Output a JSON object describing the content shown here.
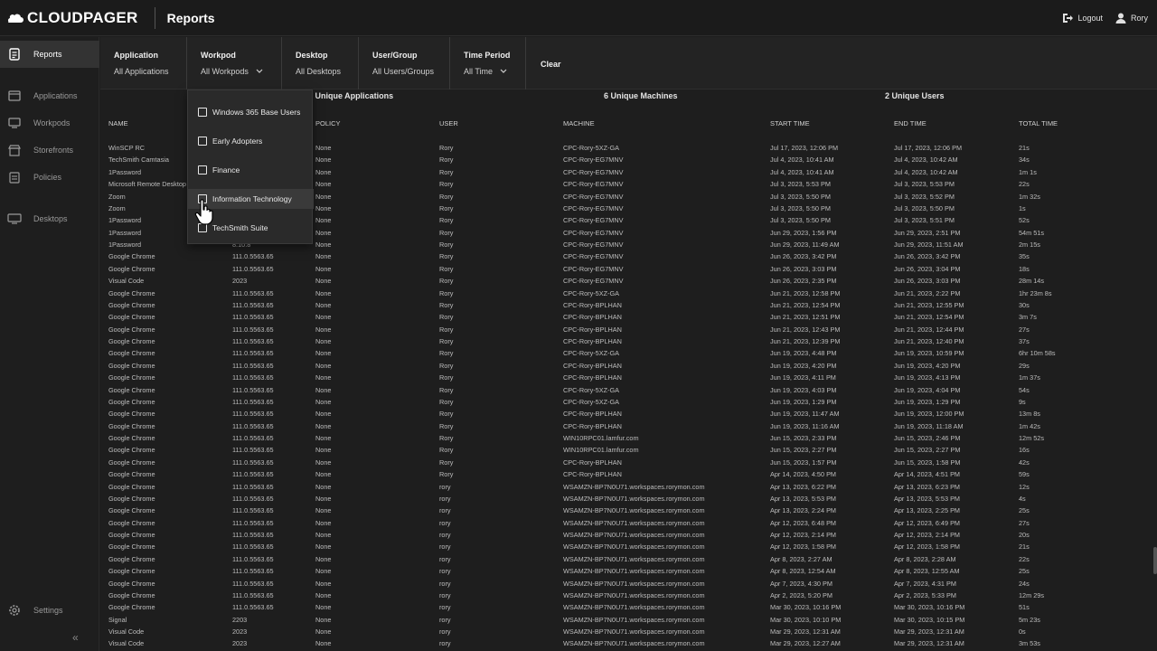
{
  "app": {
    "brand": "CLOUDPAGER",
    "page_title": "Reports",
    "logout_label": "Logout",
    "user_label": "Rory"
  },
  "sidebar": {
    "items": [
      {
        "label": "Reports",
        "icon": "report-icon"
      },
      {
        "label": "Applications",
        "icon": "applications-icon"
      },
      {
        "label": "Workpods",
        "icon": "workpods-icon"
      },
      {
        "label": "Storefronts",
        "icon": "storefront-icon"
      },
      {
        "label": "Policies",
        "icon": "policies-icon"
      },
      {
        "label": "Desktops",
        "icon": "desktops-icon"
      },
      {
        "label": "Settings",
        "icon": "gear-icon"
      }
    ],
    "collapse_glyph": "«"
  },
  "filters": {
    "application": {
      "label": "Application",
      "value": "All Applications"
    },
    "workpod": {
      "label": "Workpod",
      "value": "All Workpods"
    },
    "desktop": {
      "label": "Desktop",
      "value": "All Desktops"
    },
    "usergroup": {
      "label": "User/Group",
      "value": "All Users/Groups"
    },
    "time_period": {
      "label": "Time Period",
      "value": "All Time"
    },
    "clear_label": "Clear"
  },
  "summary": {
    "apps": "8 Unique Applications",
    "machines": "6 Unique Machines",
    "users": "2 Unique Users"
  },
  "dropdown": {
    "options": [
      "Windows 365 Base Users",
      "Early Adopters",
      "Finance",
      "Information Technology",
      "TechSmith Suite"
    ]
  },
  "table": {
    "headers": {
      "name": "NAME",
      "policy": "POLICY",
      "user": "USER",
      "machine": "MACHINE",
      "start": "START TIME",
      "end": "END TIME",
      "total": "TOTAL TIME"
    },
    "rows": [
      [
        "WinSCP RC",
        "",
        "None",
        "Rory",
        "CPC-Rory-5XZ-GA",
        "Jul 17, 2023, 12:06 PM",
        "Jul 17, 2023, 12:06 PM",
        "21s"
      ],
      [
        "TechSmith Camtasia",
        "",
        "None",
        "Rory",
        "CPC-Rory-EG7MNV",
        "Jul 4, 2023, 10:41 AM",
        "Jul 4, 2023, 10:42 AM",
        "34s"
      ],
      [
        "1Password",
        "",
        "None",
        "Rory",
        "CPC-Rory-EG7MNV",
        "Jul 4, 2023, 10:41 AM",
        "Jul 4, 2023, 10:42 AM",
        "1m 1s"
      ],
      [
        "Microsoft Remote Desktop",
        "",
        "None",
        "Rory",
        "CPC-Rory-EG7MNV",
        "Jul 3, 2023, 5:53 PM",
        "Jul 3, 2023, 5:53 PM",
        "22s"
      ],
      [
        "Zoom",
        "",
        "None",
        "Rory",
        "CPC-Rory-EG7MNV",
        "Jul 3, 2023, 5:50 PM",
        "Jul 3, 2023, 5:52 PM",
        "1m 32s"
      ],
      [
        "Zoom",
        "",
        "None",
        "Rory",
        "CPC-Rory-EG7MNV",
        "Jul 3, 2023, 5:50 PM",
        "Jul 3, 2023, 5:50 PM",
        "1s"
      ],
      [
        "1Password",
        "",
        "None",
        "Rory",
        "CPC-Rory-EG7MNV",
        "Jul 3, 2023, 5:50 PM",
        "Jul 3, 2023, 5:51 PM",
        "52s"
      ],
      [
        "1Password",
        "",
        "None",
        "Rory",
        "CPC-Rory-EG7MNV",
        "Jun 29, 2023, 1:56 PM",
        "Jun 29, 2023, 2:51 PM",
        "54m 51s"
      ],
      [
        "1Password",
        "8.10.8",
        "None",
        "Rory",
        "CPC-Rory-EG7MNV",
        "Jun 29, 2023, 11:49 AM",
        "Jun 29, 2023, 11:51 AM",
        "2m 15s"
      ],
      [
        "Google Chrome",
        "111.0.5563.65",
        "None",
        "Rory",
        "CPC-Rory-EG7MNV",
        "Jun 26, 2023, 3:42 PM",
        "Jun 26, 2023, 3:42 PM",
        "35s"
      ],
      [
        "Google Chrome",
        "111.0.5563.65",
        "None",
        "Rory",
        "CPC-Rory-EG7MNV",
        "Jun 26, 2023, 3:03 PM",
        "Jun 26, 2023, 3:04 PM",
        "18s"
      ],
      [
        "Visual Code",
        "2023",
        "None",
        "Rory",
        "CPC-Rory-EG7MNV",
        "Jun 26, 2023, 2:35 PM",
        "Jun 26, 2023, 3:03 PM",
        "28m 14s"
      ],
      [
        "Google Chrome",
        "111.0.5563.65",
        "None",
        "Rory",
        "CPC-Rory-5XZ-GA",
        "Jun 21, 2023, 12:58 PM",
        "Jun 21, 2023, 2:22 PM",
        "1hr 23m 8s"
      ],
      [
        "Google Chrome",
        "111.0.5563.65",
        "None",
        "Rory",
        "CPC-Rory-BPLHAN",
        "Jun 21, 2023, 12:54 PM",
        "Jun 21, 2023, 12:55 PM",
        "30s"
      ],
      [
        "Google Chrome",
        "111.0.5563.65",
        "None",
        "Rory",
        "CPC-Rory-BPLHAN",
        "Jun 21, 2023, 12:51 PM",
        "Jun 21, 2023, 12:54 PM",
        "3m 7s"
      ],
      [
        "Google Chrome",
        "111.0.5563.65",
        "None",
        "Rory",
        "CPC-Rory-BPLHAN",
        "Jun 21, 2023, 12:43 PM",
        "Jun 21, 2023, 12:44 PM",
        "27s"
      ],
      [
        "Google Chrome",
        "111.0.5563.65",
        "None",
        "Rory",
        "CPC-Rory-BPLHAN",
        "Jun 21, 2023, 12:39 PM",
        "Jun 21, 2023, 12:40 PM",
        "37s"
      ],
      [
        "Google Chrome",
        "111.0.5563.65",
        "None",
        "Rory",
        "CPC-Rory-5XZ-GA",
        "Jun 19, 2023, 4:48 PM",
        "Jun 19, 2023, 10:59 PM",
        "6hr 10m 58s"
      ],
      [
        "Google Chrome",
        "111.0.5563.65",
        "None",
        "Rory",
        "CPC-Rory-BPLHAN",
        "Jun 19, 2023, 4:20 PM",
        "Jun 19, 2023, 4:20 PM",
        "29s"
      ],
      [
        "Google Chrome",
        "111.0.5563.65",
        "None",
        "Rory",
        "CPC-Rory-BPLHAN",
        "Jun 19, 2023, 4:11 PM",
        "Jun 19, 2023, 4:13 PM",
        "1m 37s"
      ],
      [
        "Google Chrome",
        "111.0.5563.65",
        "None",
        "Rory",
        "CPC-Rory-5XZ-GA",
        "Jun 19, 2023, 4:03 PM",
        "Jun 19, 2023, 4:04 PM",
        "54s"
      ],
      [
        "Google Chrome",
        "111.0.5563.65",
        "None",
        "Rory",
        "CPC-Rory-5XZ-GA",
        "Jun 19, 2023, 1:29 PM",
        "Jun 19, 2023, 1:29 PM",
        "9s"
      ],
      [
        "Google Chrome",
        "111.0.5563.65",
        "None",
        "Rory",
        "CPC-Rory-BPLHAN",
        "Jun 19, 2023, 11:47 AM",
        "Jun 19, 2023, 12:00 PM",
        "13m 8s"
      ],
      [
        "Google Chrome",
        "111.0.5563.65",
        "None",
        "Rory",
        "CPC-Rory-BPLHAN",
        "Jun 19, 2023, 11:16 AM",
        "Jun 19, 2023, 11:18 AM",
        "1m 42s"
      ],
      [
        "Google Chrome",
        "111.0.5563.65",
        "None",
        "Rory",
        "WIN10RPC01.lamfur.com",
        "Jun 15, 2023, 2:33 PM",
        "Jun 15, 2023, 2:46 PM",
        "12m 52s"
      ],
      [
        "Google Chrome",
        "111.0.5563.65",
        "None",
        "Rory",
        "WIN10RPC01.lamfur.com",
        "Jun 15, 2023, 2:27 PM",
        "Jun 15, 2023, 2:27 PM",
        "16s"
      ],
      [
        "Google Chrome",
        "111.0.5563.65",
        "None",
        "Rory",
        "CPC-Rory-BPLHAN",
        "Jun 15, 2023, 1:57 PM",
        "Jun 15, 2023, 1:58 PM",
        "42s"
      ],
      [
        "Google Chrome",
        "111.0.5563.65",
        "None",
        "Rory",
        "CPC-Rory-BPLHAN",
        "Apr 14, 2023, 4:50 PM",
        "Apr 14, 2023, 4:51 PM",
        "59s"
      ],
      [
        "Google Chrome",
        "111.0.5563.65",
        "None",
        "rory",
        "WSAMZN-BP7N0U71.workspaces.rorymon.com",
        "Apr 13, 2023, 6:22 PM",
        "Apr 13, 2023, 6:23 PM",
        "12s"
      ],
      [
        "Google Chrome",
        "111.0.5563.65",
        "None",
        "rory",
        "WSAMZN-BP7N0U71.workspaces.rorymon.com",
        "Apr 13, 2023, 5:53 PM",
        "Apr 13, 2023, 5:53 PM",
        "4s"
      ],
      [
        "Google Chrome",
        "111.0.5563.65",
        "None",
        "rory",
        "WSAMZN-BP7N0U71.workspaces.rorymon.com",
        "Apr 13, 2023, 2:24 PM",
        "Apr 13, 2023, 2:25 PM",
        "25s"
      ],
      [
        "Google Chrome",
        "111.0.5563.65",
        "None",
        "rory",
        "WSAMZN-BP7N0U71.workspaces.rorymon.com",
        "Apr 12, 2023, 6:48 PM",
        "Apr 12, 2023, 6:49 PM",
        "27s"
      ],
      [
        "Google Chrome",
        "111.0.5563.65",
        "None",
        "rory",
        "WSAMZN-BP7N0U71.workspaces.rorymon.com",
        "Apr 12, 2023, 2:14 PM",
        "Apr 12, 2023, 2:14 PM",
        "20s"
      ],
      [
        "Google Chrome",
        "111.0.5563.65",
        "None",
        "rory",
        "WSAMZN-BP7N0U71.workspaces.rorymon.com",
        "Apr 12, 2023, 1:58 PM",
        "Apr 12, 2023, 1:58 PM",
        "21s"
      ],
      [
        "Google Chrome",
        "111.0.5563.65",
        "None",
        "rory",
        "WSAMZN-BP7N0U71.workspaces.rorymon.com",
        "Apr 8, 2023, 2:27 AM",
        "Apr 8, 2023, 2:28 AM",
        "22s"
      ],
      [
        "Google Chrome",
        "111.0.5563.65",
        "None",
        "rory",
        "WSAMZN-BP7N0U71.workspaces.rorymon.com",
        "Apr 8, 2023, 12:54 AM",
        "Apr 8, 2023, 12:55 AM",
        "25s"
      ],
      [
        "Google Chrome",
        "111.0.5563.65",
        "None",
        "rory",
        "WSAMZN-BP7N0U71.workspaces.rorymon.com",
        "Apr 7, 2023, 4:30 PM",
        "Apr 7, 2023, 4:31 PM",
        "24s"
      ],
      [
        "Google Chrome",
        "111.0.5563.65",
        "None",
        "rory",
        "WSAMZN-BP7N0U71.workspaces.rorymon.com",
        "Apr 2, 2023, 5:20 PM",
        "Apr 2, 2023, 5:33 PM",
        "12m 29s"
      ],
      [
        "Google Chrome",
        "111.0.5563.65",
        "None",
        "rory",
        "WSAMZN-BP7N0U71.workspaces.rorymon.com",
        "Mar 30, 2023, 10:16 PM",
        "Mar 30, 2023, 10:16 PM",
        "51s"
      ],
      [
        "Signal",
        "2203",
        "None",
        "rory",
        "WSAMZN-BP7N0U71.workspaces.rorymon.com",
        "Mar 30, 2023, 10:10 PM",
        "Mar 30, 2023, 10:15 PM",
        "5m 23s"
      ],
      [
        "Visual Code",
        "2023",
        "None",
        "rory",
        "WSAMZN-BP7N0U71.workspaces.rorymon.com",
        "Mar 29, 2023, 12:31 AM",
        "Mar 29, 2023, 12:31 AM",
        "0s"
      ],
      [
        "Visual Code",
        "2023",
        "None",
        "rory",
        "WSAMZN-BP7N0U71.workspaces.rorymon.com",
        "Mar 29, 2023, 12:27 AM",
        "Mar 29, 2023, 12:31 AM",
        "3m 53s"
      ]
    ]
  }
}
